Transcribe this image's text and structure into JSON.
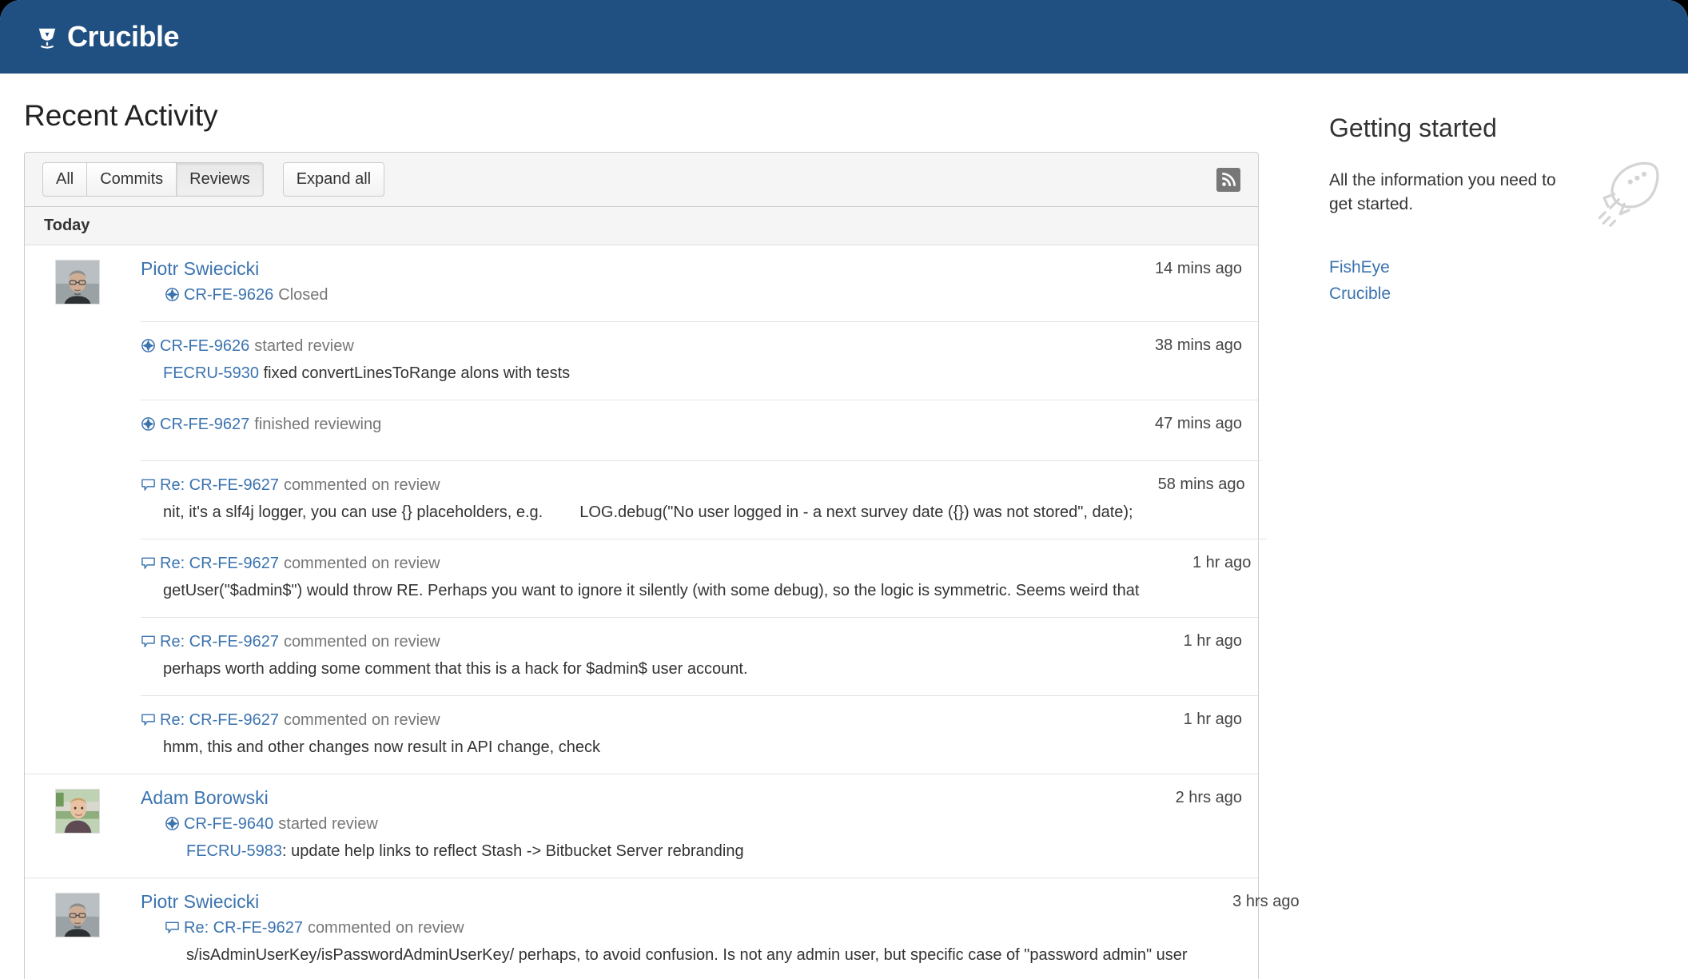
{
  "header": {
    "product_name": "Crucible",
    "logo_icon": "crucible-logo-icon",
    "bg_color": "#205081"
  },
  "page_title": "Recent Activity",
  "toolbar": {
    "filters": [
      {
        "label": "All",
        "selected": false
      },
      {
        "label": "Commits",
        "selected": false
      },
      {
        "label": "Reviews",
        "selected": true
      }
    ],
    "expand_all_label": "Expand all",
    "rss_icon": "rss-feed-icon"
  },
  "activity": {
    "day_label": "Today",
    "groups": [
      {
        "author": "Piotr Swiecicki",
        "avatar": "piotr-swiecicki-avatar",
        "rows": [
          {
            "icon": "review-target-icon",
            "key": "CR-FE-9626",
            "verb": "Closed",
            "detail": "",
            "detail_key": "",
            "detail_tail": "",
            "time": "14 mins ago",
            "sub": false
          },
          {
            "icon": "review-target-icon",
            "key": "CR-FE-9626",
            "verb": "started review",
            "detail_key": "FECRU-5930",
            "detail": " fixed convertLinesToRange alons with tests",
            "detail_tail": "",
            "time": "38 mins ago",
            "sub": true
          },
          {
            "icon": "review-target-icon",
            "key": "CR-FE-9627",
            "verb": "finished reviewing",
            "detail_key": "",
            "detail": "",
            "detail_tail": "",
            "time": "47 mins ago",
            "sub": true
          },
          {
            "icon": "comment-bubble-icon",
            "key": "Re: CR-FE-9627",
            "verb": "commented on review",
            "detail_key": "",
            "detail": "nit, it's a slf4j logger, you can use {} placeholders, e.g.",
            "detail_tail": "LOG.debug(\"No user logged in - a next survey date ({}) was not stored\", date);",
            "time": "58 mins ago",
            "sub": true
          },
          {
            "icon": "comment-bubble-icon",
            "key": "Re: CR-FE-9627",
            "verb": "commented on review",
            "detail_key": "",
            "detail": "getUser(\"$admin$\") would throw RE. Perhaps you want to ignore it silently (with some debug), so the logic is symmetric. Seems weird that",
            "detail_tail": "",
            "time": "1 hr ago",
            "sub": true
          },
          {
            "icon": "comment-bubble-icon",
            "key": "Re: CR-FE-9627",
            "verb": "commented on review",
            "detail_key": "",
            "detail": "perhaps worth adding some comment that this is a hack for $admin$ user account.",
            "detail_tail": "",
            "time": "1 hr ago",
            "sub": true
          },
          {
            "icon": "comment-bubble-icon",
            "key": "Re: CR-FE-9627",
            "verb": "commented on review",
            "detail_key": "",
            "detail": "hmm, this and other changes now result in API change, check",
            "detail_tail": "",
            "time": "1 hr ago",
            "sub": true
          }
        ]
      },
      {
        "author": "Adam Borowski",
        "avatar": "adam-borowski-avatar",
        "rows": [
          {
            "icon": "review-target-icon",
            "key": "CR-FE-9640",
            "verb": "started review",
            "detail_key": "FECRU-5983",
            "detail": ": update help links to reflect Stash -> Bitbucket Server rebranding",
            "detail_tail": "",
            "time": "2 hrs ago",
            "sub": false
          }
        ]
      },
      {
        "author": "Piotr Swiecicki",
        "avatar": "piotr-swiecicki-avatar",
        "rows": [
          {
            "icon": "comment-bubble-icon",
            "key": "Re: CR-FE-9627",
            "verb": "commented on review",
            "detail_key": "",
            "detail": "s/isAdminUserKey/isPasswordAdminUserKey/ perhaps, to avoid confusion. Is not any admin user, but specific case of \"password admin\" user",
            "detail_tail": "",
            "time": "3 hrs ago",
            "sub": false
          }
        ]
      }
    ]
  },
  "sidebar": {
    "title": "Getting started",
    "description": "All the information you need to get started.",
    "rocket_icon": "rocket-icon",
    "links": [
      {
        "label": "FishEye"
      },
      {
        "label": "Crucible"
      }
    ]
  },
  "colors": {
    "brand_blue": "#205081",
    "link_blue": "#3b73af",
    "muted_text": "#777777"
  }
}
